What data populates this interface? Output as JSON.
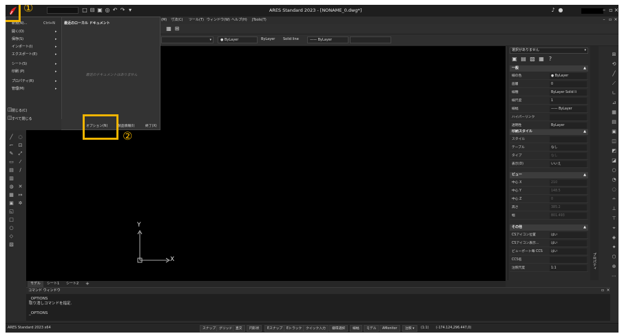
{
  "window": {
    "title": "ARES Standard 2023 - [NONAME_0.dwg*]"
  },
  "menubar": {
    "items": [
      "(M)",
      "寸法(C)",
      "ツール(T)",
      "ウィンドウ(W)",
      "ヘルプ(H)",
      "JTools(T)"
    ]
  },
  "toolbar3": {
    "color_combo": "● ByLayer",
    "linetype_combo": "ByLayer",
    "lineweight_label": "Solid line",
    "plotstyle_combo": "—— ByLayer"
  },
  "app_menu": {
    "items": [
      {
        "label": "新規(N)...",
        "shortcut": "Ctrl+N",
        "arrow": ""
      },
      {
        "label": "開く(O)",
        "shortcut": "",
        "arrow": "▸"
      },
      {
        "label": "保存(S)",
        "shortcut": "",
        "arrow": "▸"
      },
      {
        "label": "インポート(I)",
        "shortcut": "",
        "arrow": "▸"
      },
      {
        "label": "エクスポート(E)",
        "shortcut": "",
        "arrow": "▸"
      },
      {
        "label": "シート(S)",
        "shortcut": "",
        "arrow": "▸"
      },
      {
        "label": "印刷 (P)",
        "shortcut": "",
        "arrow": "▸"
      },
      {
        "label": "プロパティ(R)",
        "shortcut": "",
        "arrow": "▸"
      },
      {
        "label": "管理(M)",
        "shortcut": "",
        "arrow": "▸"
      },
      {
        "label": "閉じる(C)",
        "shortcut": "",
        "arrow": ""
      },
      {
        "label": "すべて閉じる",
        "shortcut": "",
        "arrow": ""
      }
    ],
    "recent_title": "最近のローカル ドキュメント",
    "recent_empty": "最近のドキュメントはありません",
    "options_button": "オプション(N)",
    "license_button": "製品情報(I)",
    "exit_button": "終了(X)"
  },
  "properties": {
    "selector": "選択がありません",
    "sections": {
      "general": {
        "title": "一般",
        "rows": [
          {
            "label": "線の色",
            "value": "● ByLayer"
          },
          {
            "label": "画層",
            "value": "0"
          },
          {
            "label": "線種",
            "value": "ByLayer    Solid li"
          },
          {
            "label": "線尺度",
            "value": "1"
          },
          {
            "label": "線幅",
            "value": "—— ByLayer"
          },
          {
            "label": "ハイパーリンク",
            "value": ""
          },
          {
            "label": "透明性",
            "value": "ByLayer"
          }
        ]
      },
      "print_style": {
        "title": "印刷スタイル",
        "rows": [
          {
            "label": "スタイル",
            "value": ""
          },
          {
            "label": "テーブル",
            "value": "なし"
          },
          {
            "label": "タイプ",
            "value": "なし"
          },
          {
            "label": "表示(D)",
            "value": "いいえ"
          }
        ]
      },
      "view": {
        "title": "ビュー",
        "rows": [
          {
            "label": "中心 X",
            "value": "210"
          },
          {
            "label": "中心 Y",
            "value": "148.5"
          },
          {
            "label": "中心 Z",
            "value": "0"
          },
          {
            "label": "高さ",
            "value": "385.2"
          },
          {
            "label": "幅",
            "value": "801.493"
          }
        ]
      },
      "other": {
        "title": "その他",
        "rows": [
          {
            "label": "CSアイコン位置",
            "value": "はい"
          },
          {
            "label": "CSアイコン表示...",
            "value": "はい"
          },
          {
            "label": "ビューポート毎 CCS",
            "value": "はい"
          },
          {
            "label": "CCS名",
            "value": ""
          },
          {
            "label": "注釈尺度",
            "value": "1:1"
          }
        ]
      }
    },
    "side_tab": "プロパティ"
  },
  "layout_tabs": [
    "モデル",
    "シート1",
    "シート2",
    "+"
  ],
  "command_window": {
    "title": "コマンド ウィンドウ",
    "lines": [
      "_OPTIONS",
      "取り消しコマンドを指定.",
      "",
      "_OPTIONS"
    ]
  },
  "statusbar": {
    "left_text": "ARES Standard 2023 x64",
    "buttons": [
      "スナップ",
      "グリッド",
      "直交",
      "円形状",
      "Eスナップ",
      "Eトラック",
      "クイック入力",
      "循環選択",
      "線幅",
      "モデル",
      "AMonitor",
      "注釈 ▾",
      "(1:1)",
      "(-174.124,296.447,0)"
    ]
  },
  "ucs": {
    "x_label": "X",
    "y_label": "Y"
  },
  "annotations": {
    "marker_1": "①",
    "marker_2": "②"
  },
  "colors": {
    "accent_highlight": "#f0b400",
    "canvas": "#000000",
    "logo": "#e02020"
  }
}
